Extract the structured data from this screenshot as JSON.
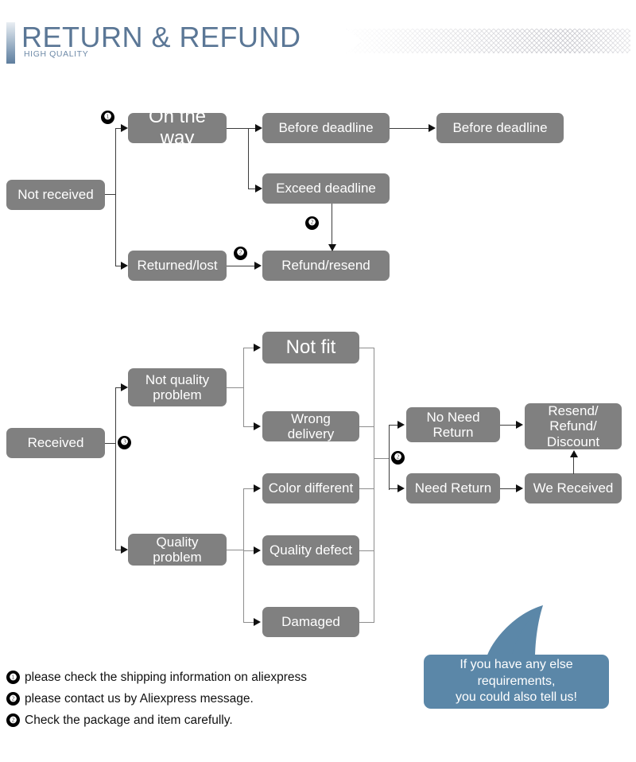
{
  "header": {
    "title": "RETURN & REFUND",
    "subtitle": "HIGH QUALITY",
    "title_color": "#5b7796",
    "accent_color": "#5f7e9e"
  },
  "theme": {
    "node_fill": "#808080",
    "node_text": "#ffffff",
    "connector": "#3d3d3d",
    "badge_fill": "#000000",
    "bubble_fill": "#5b87a8",
    "background": "#ffffff"
  },
  "flow_not_received": {
    "root": "Not received",
    "nodes": {
      "on_the_way": "On the way",
      "before_deadline_1": "Before deadline",
      "before_deadline_2": "Before deadline",
      "exceed_deadline": "Exceed deadline",
      "returned_lost": "Returned/lost",
      "refund_resend": "Refund/resend"
    },
    "badges": {
      "root_split": "❶",
      "exceed_to_refund": "❷",
      "returned_to_refund": "❷"
    }
  },
  "flow_received": {
    "root": "Received",
    "nodes": {
      "not_quality_problem": "Not quality\nproblem",
      "quality_problem": "Quality problem",
      "not_fit": "Not fit",
      "wrong_delivery": "Wrong delivery",
      "color_different": "Color different",
      "quality_defect": "Quality defect",
      "damaged": "Damaged",
      "no_need_return": "No Need\nReturn",
      "need_return": "Need Return",
      "we_received": "We Received",
      "resend_refund_discount": "Resend/\nRefund/\nDiscount"
    },
    "badges": {
      "root_split": "❸",
      "return_split": "❷"
    }
  },
  "legend": [
    {
      "badge": "❶",
      "text": "please check the shipping information on aliexpress"
    },
    {
      "badge": "❷",
      "text": "please contact us by Aliexpress message."
    },
    {
      "badge": "❷",
      "text": "Check the package and item carefully."
    }
  ],
  "bubble": {
    "text": "If you have any else\nrequirements,\nyou could also tell us!"
  }
}
